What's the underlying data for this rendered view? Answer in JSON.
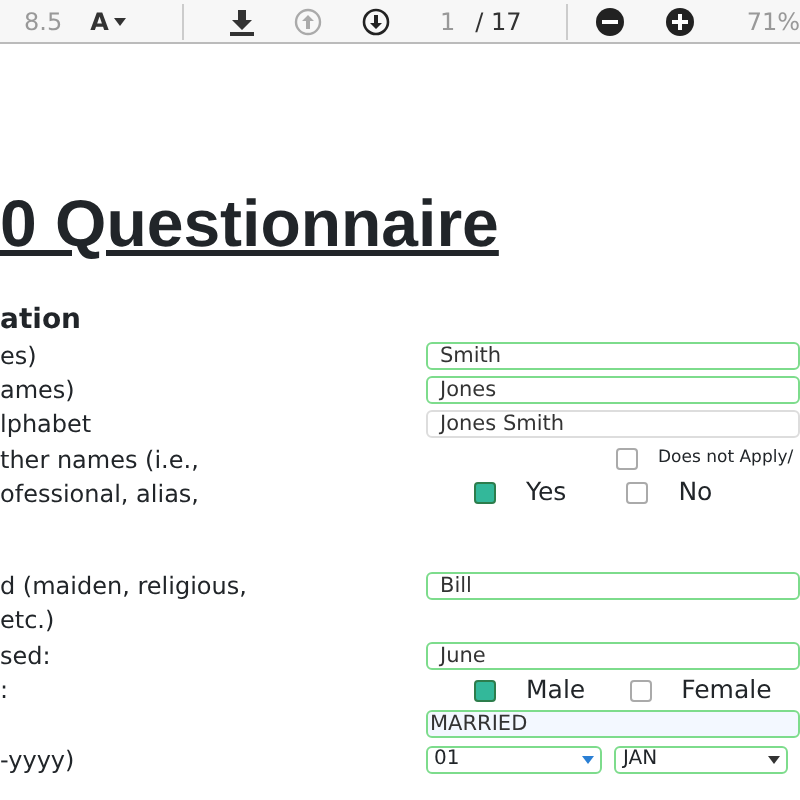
{
  "toolbar": {
    "font_size": "8.5",
    "font_button": "A",
    "page_current": "1",
    "page_total": "/ 17",
    "zoom": "71%"
  },
  "title": "0 Questionnaire",
  "section_heading": "ation",
  "rows": [
    {
      "label": "es)",
      "kind": "field",
      "value": "Smith",
      "highlighted": true
    },
    {
      "label": "ames)",
      "kind": "field",
      "value": "Jones",
      "highlighted": true
    },
    {
      "label": "lphabet",
      "kind": "field",
      "value": "Jones Smith",
      "highlighted": false
    },
    {
      "label": "ther names (i.e.,",
      "kind": "checkbox",
      "options": [
        {
          "label": "Does not Apply/",
          "checked": false
        }
      ]
    },
    {
      "label": "ofessional, alias,",
      "kind": "choices",
      "options": [
        {
          "label": "Yes",
          "checked": true
        },
        {
          "label": "No",
          "checked": false
        }
      ]
    },
    {
      "label": "d (maiden, religious,",
      "kind": "field",
      "value": "Bill",
      "highlighted": true
    },
    {
      "label": "etc.)",
      "kind": "none"
    },
    {
      "label": "sed:",
      "kind": "field",
      "value": "June",
      "highlighted": true
    },
    {
      "label": ":",
      "kind": "choices",
      "options": [
        {
          "label": "Male",
          "checked": true
        },
        {
          "label": "Female",
          "checked": false
        }
      ]
    },
    {
      "kind": "field",
      "value": "MARRIED",
      "highlighted": true
    },
    {
      "label": "-yyyy)",
      "kind": "selects",
      "items": [
        {
          "value": "01"
        },
        {
          "value": "JAN"
        }
      ]
    }
  ]
}
